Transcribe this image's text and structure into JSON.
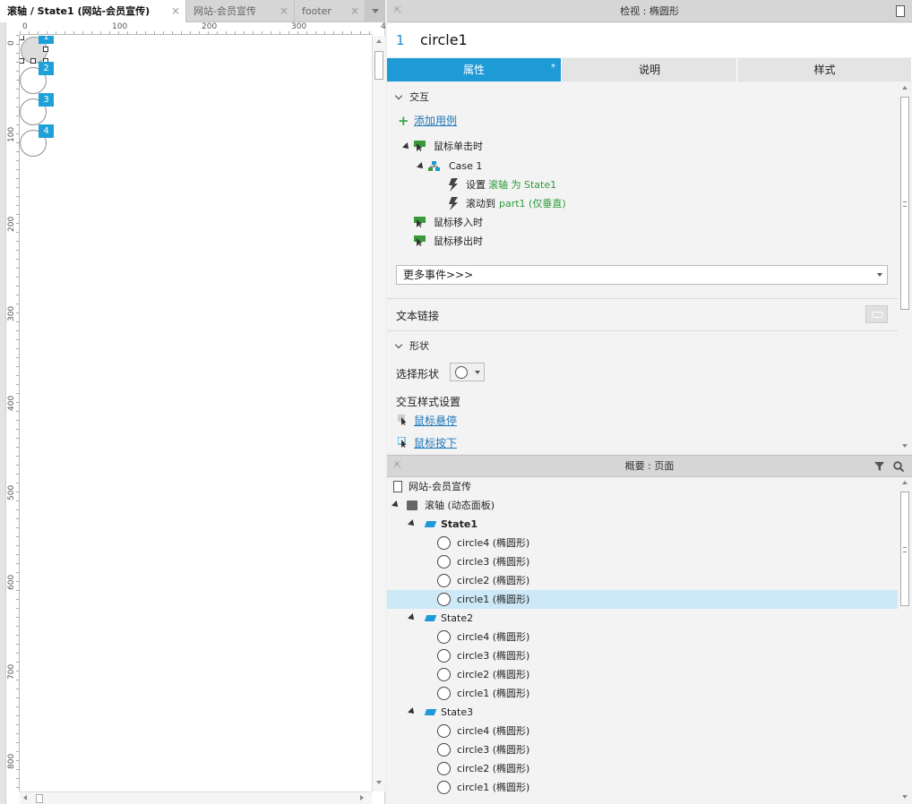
{
  "doc_tabs": [
    {
      "label": "滚轴 / State1 (网站-会员宣传)",
      "active": true
    },
    {
      "label": "网站-会员宣传",
      "active": false
    },
    {
      "label": "footer",
      "active": false
    }
  ],
  "ruler": {
    "top_labels": [
      "0",
      "100",
      "200",
      "300",
      "4"
    ],
    "left_labels": [
      "0",
      "100",
      "200",
      "300",
      "400",
      "500",
      "600",
      "700",
      "800"
    ]
  },
  "canvas": {
    "badges": [
      "1",
      "2",
      "3",
      "4"
    ]
  },
  "inspector": {
    "header_title": "检视 : 椭圆形",
    "element_number": "1",
    "element_name": "circle1",
    "tabs": [
      "属性",
      "说明",
      "样式"
    ],
    "active_tab_marker": "*",
    "interaction_section": "交互",
    "add_case": "添加用例",
    "events": {
      "click": "鼠标单击时",
      "case": "Case 1",
      "action1_prefix": "设置",
      "action1_value": "滚轴 为 State1",
      "action2_prefix": "滚动到",
      "action2_value": "part1 (仅垂直)",
      "mouse_enter": "鼠标移入时",
      "mouse_leave": "鼠标移出时"
    },
    "more_events": "更多事件>>>",
    "text_link": "文本链接",
    "shape_section": "形状",
    "select_shape": "选择形状",
    "interaction_style": "交互样式设置",
    "hover": "鼠标悬停",
    "mouse_down": "鼠标按下"
  },
  "outline": {
    "header_title": "概要 : 页面",
    "page": "网站-会员宣传",
    "panel": "滚轴 (动态面板)",
    "states": [
      {
        "name": "State1",
        "bold": true,
        "items": [
          "circle4 (椭圆形)",
          "circle3 (椭圆形)",
          "circle2 (椭圆形)",
          "circle1 (椭圆形)"
        ]
      },
      {
        "name": "State2",
        "bold": false,
        "items": [
          "circle4 (椭圆形)",
          "circle3 (椭圆形)",
          "circle2 (椭圆形)",
          "circle1 (椭圆形)"
        ]
      },
      {
        "name": "State3",
        "bold": false,
        "items": [
          "circle4 (椭圆形)",
          "circle3 (椭圆形)",
          "circle2 (椭圆形)",
          "circle1 (椭圆形)"
        ]
      }
    ],
    "selected_item": "circle1 (椭圆形)"
  },
  "colors": {
    "accent": "#1e9ad6",
    "link": "#1e77b8",
    "green": "#2e9b3a",
    "selection": "#cde8f6"
  }
}
